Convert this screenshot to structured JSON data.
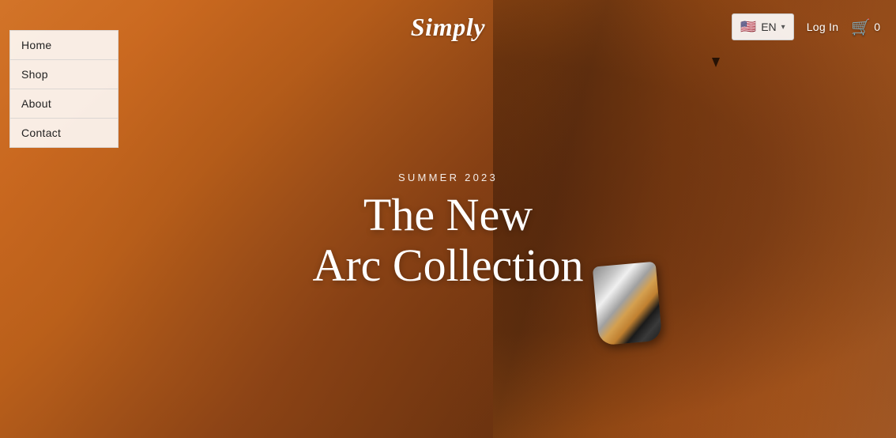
{
  "brand": {
    "name": "Simply"
  },
  "header": {
    "lang_label": "EN",
    "login_label": "Log In",
    "cart_count": "0"
  },
  "nav": {
    "items": [
      {
        "label": "Home"
      },
      {
        "label": "Shop"
      },
      {
        "label": "About"
      },
      {
        "label": "Contact"
      }
    ]
  },
  "hero": {
    "subtitle": "SUMMER 2023",
    "title_line1": "The New",
    "title_line2": "Arc Collection"
  },
  "icons": {
    "flag": "🇺🇸",
    "chevron": "▾",
    "cart": "🛒"
  }
}
